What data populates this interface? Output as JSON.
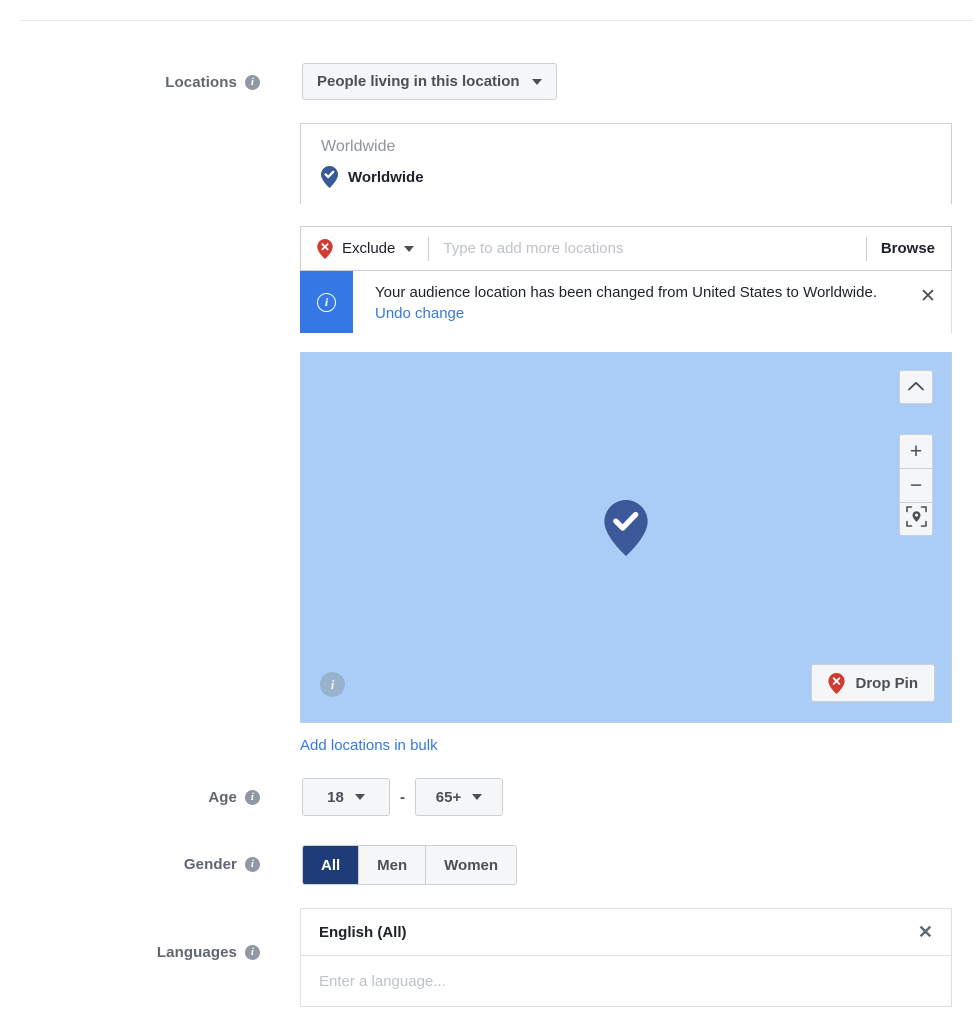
{
  "locations": {
    "label": "Locations",
    "info_icon": "info-icon",
    "select_value": "People living in this location",
    "caret_icon": "chevron-down-icon",
    "panel_header": "Worldwide",
    "selected_chip": {
      "label": "Worldwide",
      "icon": "map-pin-check-icon"
    },
    "exclude": {
      "label": "Exclude",
      "icon": "map-pin-exclude-icon",
      "caret_icon": "chevron-down-icon"
    },
    "search_placeholder": "Type to add more locations",
    "search_value": "",
    "browse_label": "Browse",
    "bulk_link": "Add locations in bulk"
  },
  "notice": {
    "icon": "info-circle-icon",
    "text": "Your audience location has been changed from United States to Worldwide.",
    "link": "Undo change",
    "close_icon": "close-icon"
  },
  "map": {
    "pin_icon": "map-pin-check-icon",
    "collapse_icon": "chevron-up-icon",
    "zoom_in_label": "+",
    "zoom_out_label": "−",
    "locate_icon": "locate-pin-icon",
    "info_icon": "info-icon",
    "drop_pin_label": "Drop Pin",
    "drop_pin_icon": "map-pin-exclude-icon"
  },
  "age": {
    "label": "Age",
    "info_icon": "info-icon",
    "min_value": "18",
    "max_value": "65+",
    "separator": "-",
    "caret_icon": "chevron-down-icon"
  },
  "gender": {
    "label": "Gender",
    "info_icon": "info-icon",
    "options": [
      {
        "label": "All",
        "selected": true
      },
      {
        "label": "Men",
        "selected": false
      },
      {
        "label": "Women",
        "selected": false
      }
    ]
  },
  "languages": {
    "label": "Languages",
    "info_icon": "info-icon",
    "selected": "English (All)",
    "remove_icon": "close-icon",
    "placeholder": "Enter a language...",
    "input_value": ""
  },
  "colors": {
    "accent_blue": "#3578e5",
    "navy": "#1d3c78",
    "map_water": "#aacdf7",
    "pin_blue": "#3b5998",
    "pin_red": "#d23b33",
    "label_gray": "#606770",
    "border": "#ccd0d5"
  }
}
